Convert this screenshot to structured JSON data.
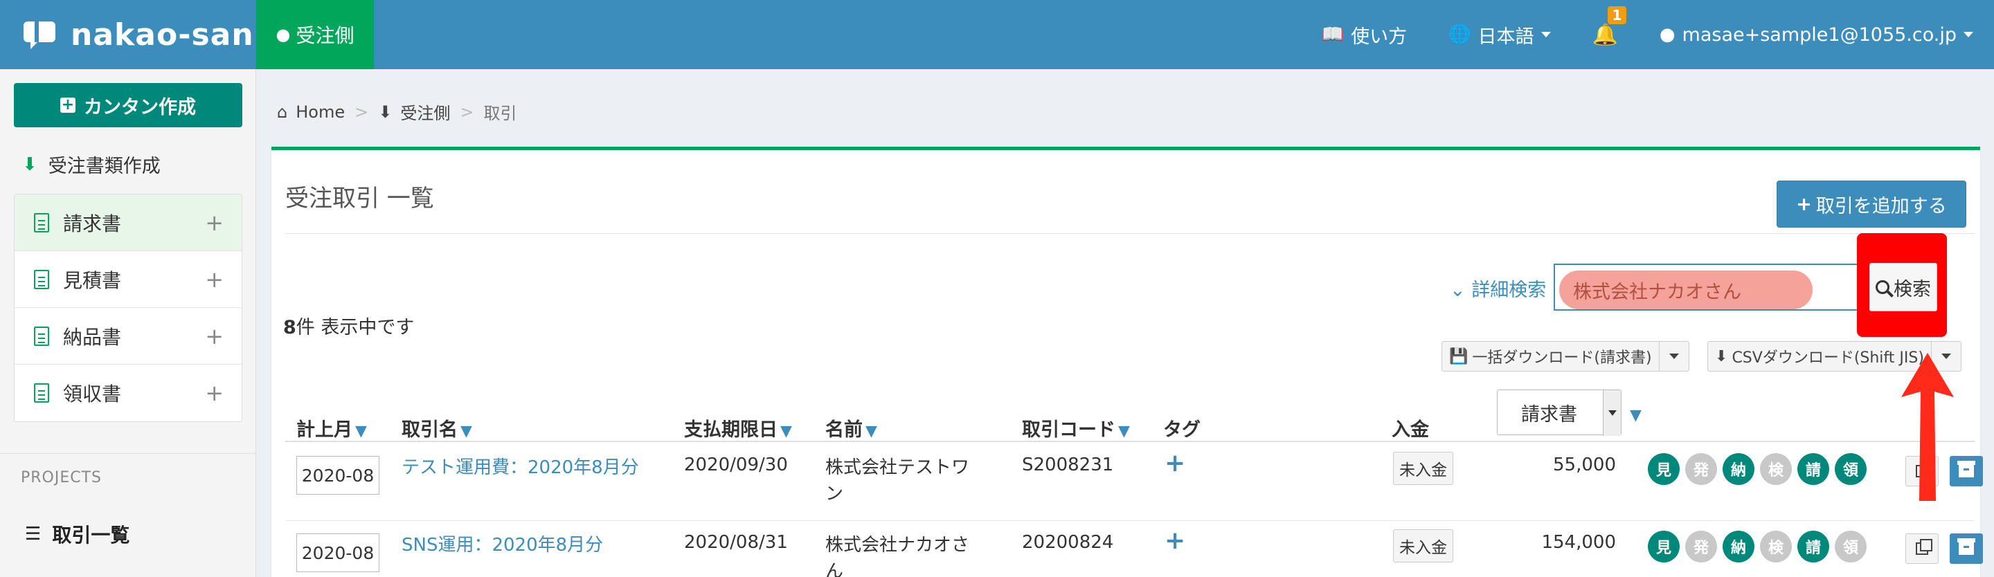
{
  "app": {
    "logo_text": "nakao-san",
    "mode_tab": "受注側"
  },
  "nav": {
    "help": "使い方",
    "language": "日本語",
    "notification_count": "1",
    "user_email": "masae+sample1@1055.co.jp"
  },
  "sidebar": {
    "easy_create": "カンタン作成",
    "doc_create": "受注書類作成",
    "doc_items": [
      {
        "label": "請求書"
      },
      {
        "label": "見積書"
      },
      {
        "label": "納品書"
      },
      {
        "label": "領収書"
      }
    ],
    "projects_label": "PROJECTS",
    "deal_list": "取引一覧"
  },
  "breadcrumb": {
    "home": "Home",
    "level2": "受注側",
    "current": "取引"
  },
  "main": {
    "title": "受注取引 一覧",
    "add_button": "取引を追加する",
    "advanced_search": "詳細検索",
    "search_value": "株式会社ナカオさん",
    "search_button": "検索",
    "count_number": "8",
    "count_suffix": "件 表示中です",
    "bulk_download": "一括ダウンロード(請求書)",
    "csv_download": "CSVダウンロード(Shift JIS)",
    "doc_type_select": "請求書"
  },
  "table": {
    "headers": {
      "month": "計上月",
      "name": "取引名",
      "due": "支払期限日",
      "client": "名前",
      "code": "取引コード",
      "tag": "タグ",
      "payment": "入金"
    },
    "rows": [
      {
        "month": "2020-08",
        "name": "テスト運用費：2020年8月分",
        "due": "2020/09/30",
        "client_line1": "株式会社テストワ",
        "client_line2": "ン",
        "code": "S2008231",
        "payment": "未入金",
        "amount": "55,000",
        "badges": [
          "見",
          "発",
          "納",
          "検",
          "請",
          "領"
        ]
      },
      {
        "month": "2020-08",
        "name": "SNS運用：2020年8月分",
        "due": "2020/08/31",
        "client_line1": "株式会社ナカオさ",
        "client_line2": "ん",
        "code": "20200824",
        "payment": "未入金",
        "amount": "154,000",
        "badges": [
          "見",
          "発",
          "納",
          "検",
          "請",
          "領"
        ]
      }
    ]
  },
  "colors": {
    "header_blue": "#3c8dbc",
    "active_green": "#00a65a",
    "teal": "#00897b",
    "highlight_red": "#ff0000"
  }
}
